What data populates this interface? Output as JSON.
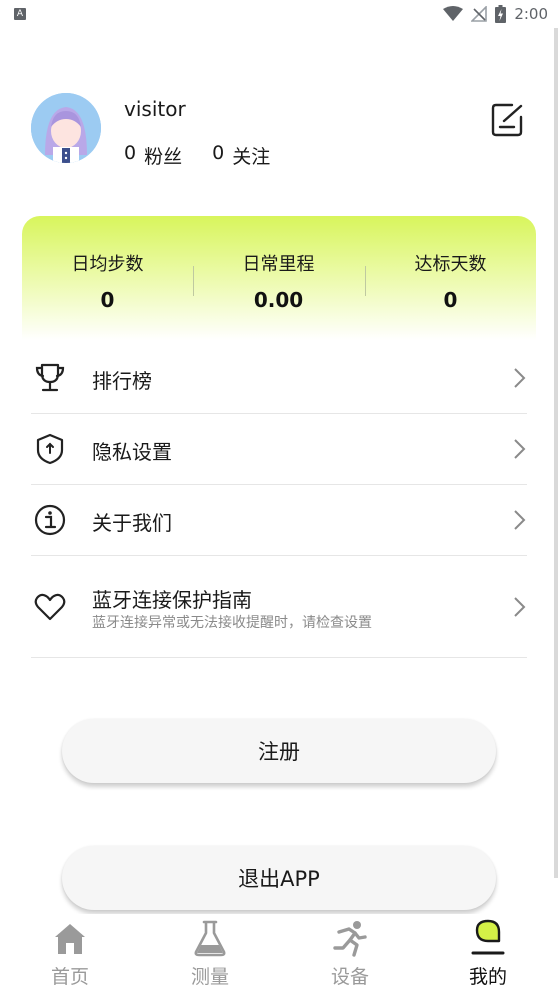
{
  "status_bar": {
    "notification_glyph": "A",
    "time": "2:00",
    "icons": [
      "wifi-icon",
      "no-signal-icon",
      "battery-charging-icon"
    ]
  },
  "profile": {
    "username": "visitor",
    "followers_count": "0",
    "followers_label": "粉丝",
    "following_count": "0",
    "following_label": "关注",
    "edit_icon": "edit-icon"
  },
  "stats": [
    {
      "label": "日均步数",
      "value": "0"
    },
    {
      "label": "日常里程",
      "value": "0.00"
    },
    {
      "label": "达标天数",
      "value": "0"
    }
  ],
  "menu": [
    {
      "label": "排行榜",
      "icon": "trophy-icon"
    },
    {
      "label": "隐私设置",
      "icon": "shield-icon"
    },
    {
      "label": "关于我们",
      "icon": "info-icon"
    },
    {
      "label": "蓝牙连接保护指南",
      "sublabel": "蓝牙连接异常或无法接收提醒时，请检查设置",
      "icon": "heart-icon"
    }
  ],
  "buttons": {
    "register": "注册",
    "logout": "退出APP"
  },
  "bottom_nav": [
    {
      "label": "首页",
      "icon": "home-icon",
      "active": false
    },
    {
      "label": "测量",
      "icon": "flask-icon",
      "active": false
    },
    {
      "label": "设备",
      "icon": "runner-icon",
      "active": false
    },
    {
      "label": "我的",
      "icon": "profile-icon",
      "active": true
    }
  ],
  "colors": {
    "accent": "#d4f047",
    "card_gradient_top": "#d8f55c",
    "text_primary": "#1a1a1a",
    "text_secondary": "#8a8a8a",
    "nav_inactive": "#9a9a9a"
  }
}
